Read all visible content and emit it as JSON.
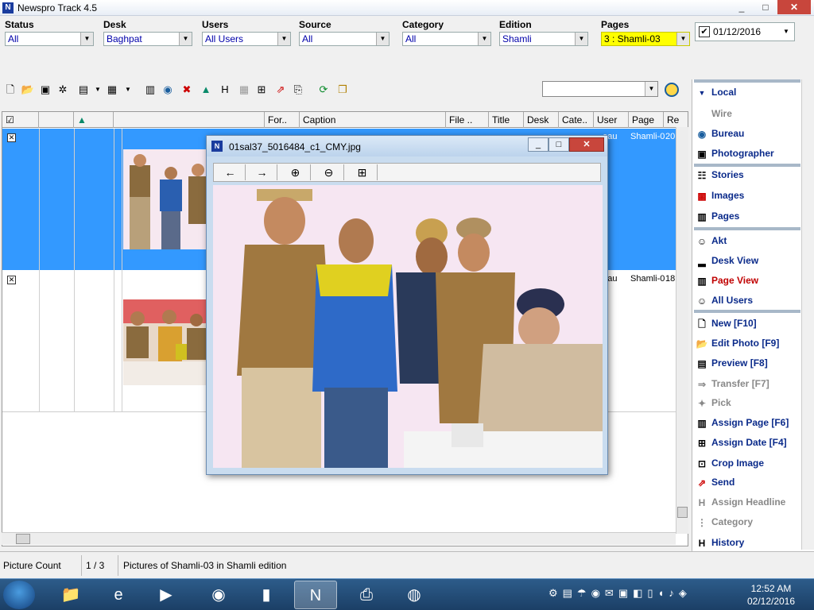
{
  "window": {
    "title": "Newspro Track 4.5",
    "controls": [
      "_",
      "□",
      "✕"
    ]
  },
  "filters": {
    "status": {
      "label": "Status",
      "value": "All"
    },
    "desk": {
      "label": "Desk",
      "value": "Baghpat"
    },
    "users": {
      "label": "Users",
      "value": "All Users"
    },
    "source": {
      "label": "Source",
      "value": "All"
    },
    "category": {
      "label": "Category",
      "value": "All"
    },
    "edition": {
      "label": "Edition",
      "value": "Shamli"
    },
    "pages": {
      "label": "Pages",
      "value": "3 : Shamli-03"
    },
    "date": {
      "checked": "✔",
      "value": "01/12/2016"
    }
  },
  "grid": {
    "columns": [
      "☑",
      "",
      "",
      "",
      "For..",
      "Caption",
      "File ..",
      "Title",
      "Desk",
      "Cate..",
      "User",
      "Page",
      "Re"
    ],
    "rows": [
      {
        "user": "...eau",
        "page": "Shamli-0",
        "re": "20..."
      },
      {
        "user": "...eau",
        "page": "Shamli-0",
        "re": "18..."
      }
    ]
  },
  "viewer": {
    "title": "01sal37_5016484_c1_CMY.jpg",
    "tools": [
      "back-arrow",
      "forward-arrow",
      "zoom-in",
      "zoom-out",
      "fit"
    ]
  },
  "statusbar": {
    "picture_count_label": "Picture Count",
    "count": "1 / 3",
    "message": "Pictures of Shamli-03 in Shamli edition"
  },
  "right_panel": {
    "local": "Local",
    "items": [
      {
        "label": "Wire",
        "state": "disabled"
      },
      {
        "label": "Bureau",
        "state": "normal"
      },
      {
        "label": "Photographer",
        "state": "normal"
      },
      {
        "label": "Stories",
        "state": "normal"
      },
      {
        "label": "Images",
        "state": "normal"
      },
      {
        "label": "Pages",
        "state": "normal"
      },
      {
        "label": "Akt",
        "state": "normal"
      },
      {
        "label": "Desk View",
        "state": "normal"
      },
      {
        "label": "Page View",
        "state": "active"
      },
      {
        "label": "All Users",
        "state": "normal"
      },
      {
        "label": "New [F10]",
        "state": "normal"
      },
      {
        "label": "Edit Photo [F9]",
        "state": "normal"
      },
      {
        "label": "Preview [F8]",
        "state": "normal"
      },
      {
        "label": "Transfer [F7]",
        "state": "disabled"
      },
      {
        "label": "Pick",
        "state": "disabled"
      },
      {
        "label": "Assign Page [F6]",
        "state": "normal"
      },
      {
        "label": "Assign Date [F4]",
        "state": "normal"
      },
      {
        "label": "Crop Image",
        "state": "normal"
      },
      {
        "label": "Send",
        "state": "normal"
      },
      {
        "label": "Assign Headline",
        "state": "disabled"
      },
      {
        "label": "Category",
        "state": "disabled"
      },
      {
        "label": "History",
        "state": "normal"
      }
    ]
  },
  "taskbar": {
    "clock_time": "12:52 AM",
    "clock_date": "02/12/2016"
  },
  "colors": {
    "selection": "#3399ff",
    "accent_blue": "#0a2a8a",
    "highlight": "#ffff00"
  }
}
